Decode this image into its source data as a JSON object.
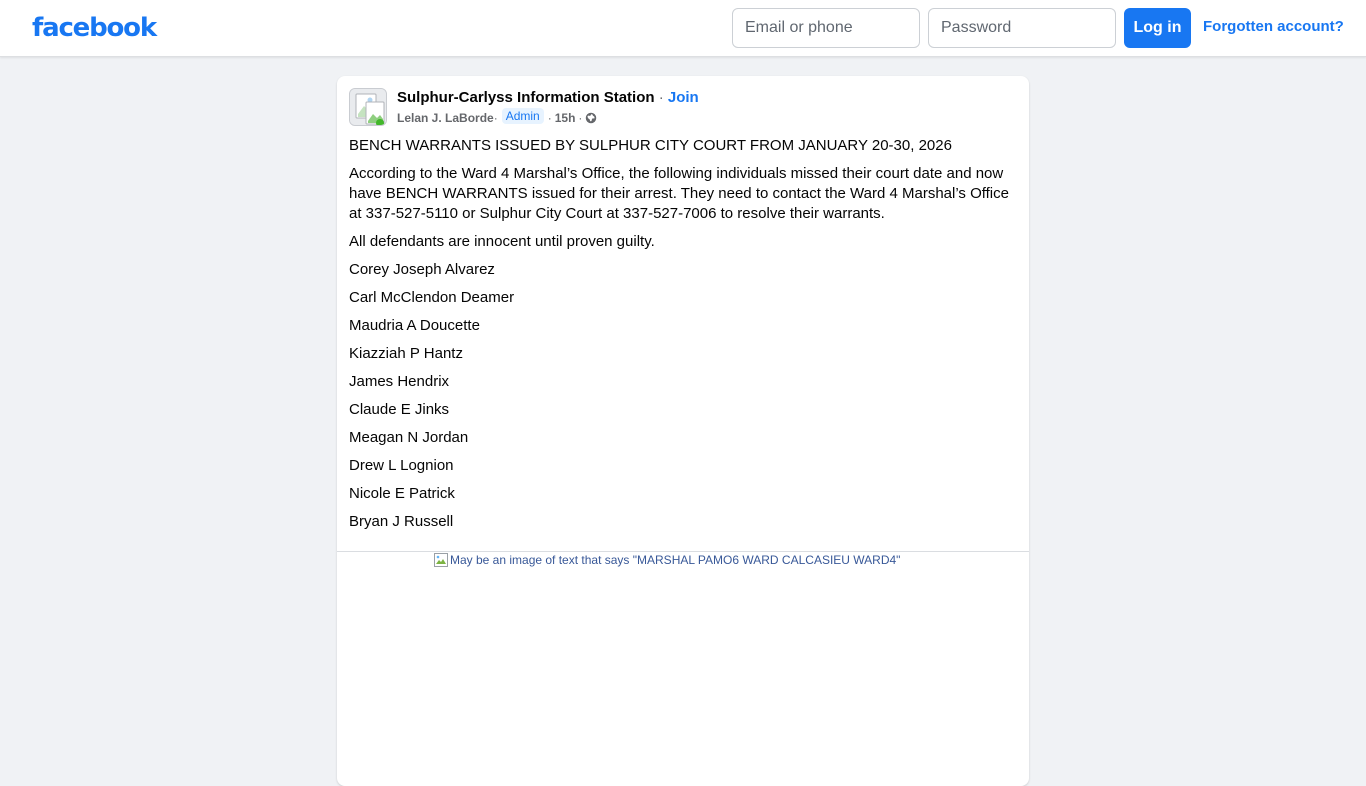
{
  "header": {
    "logo_text": "facebook",
    "email_placeholder": "Email or phone",
    "password_placeholder": "Password",
    "login_label": "Log in",
    "forgot_label": "Forgotten account?"
  },
  "post": {
    "group_name": "Sulphur-Carlyss Information Station",
    "separator": " · ",
    "join_label": "Join",
    "author": "Lelan J. LaBorde",
    "author_sep": " ·",
    "admin_badge": "Admin",
    "time_prefix": "·",
    "time": "15h",
    "time_sep": "·",
    "privacy_icon": "globe-icon",
    "title": "BENCH WARRANTS ISSUED BY SULPHUR CITY COURT FROM JANUARY 20-30, 2026",
    "intro": "According to the Ward 4 Marshal’s Office, the following individuals missed their court date and now have BENCH WARRANTS issued for their arrest. They need to contact the Ward 4 Marshal’s Office at 337-527-5110 or Sulphur City Court at 337-527-7006 to resolve their warrants.",
    "disclaimer": "All defendants are innocent until proven guilty.",
    "names": [
      "Corey Joseph Alvarez",
      "Carl McClendon Deamer",
      "Maudria A Doucette",
      "Kiazziah P Hantz",
      "James Hendrix",
      "Claude E Jinks",
      "Meagan N Jordan",
      "Drew L Lognion",
      "Nicole E Patrick",
      "Bryan J Russell"
    ],
    "image_alt": "May be an image of text that says \"MARSHAL PAMO6 WARD CALCASIEU WARD4\""
  },
  "colors": {
    "brand": "#1877f2",
    "background": "#f0f2f5",
    "card": "#ffffff",
    "secondary_text": "#65676b"
  }
}
